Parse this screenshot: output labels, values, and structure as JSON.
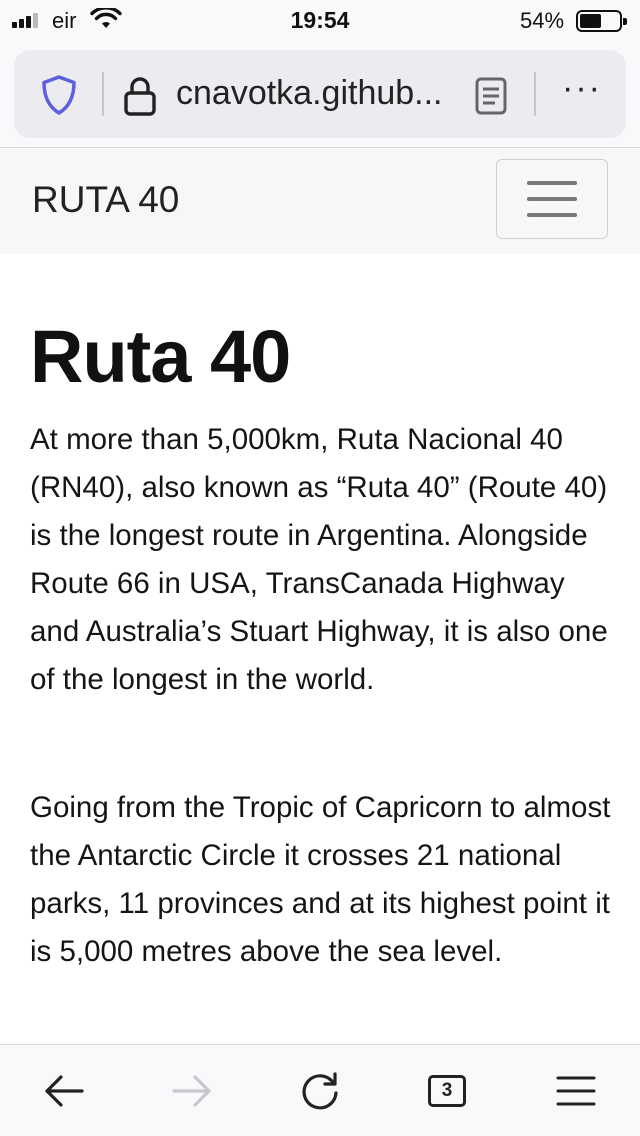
{
  "status_bar": {
    "carrier": "eir",
    "time": "19:54",
    "battery_percent": "54%",
    "battery_level": 0.54,
    "signal_bars": 3
  },
  "browser": {
    "url": "cnavotka.github...",
    "menu_label": "···",
    "tab_count": "3",
    "icons": {
      "shield": "tracking-protection-shield-icon",
      "lock": "lock-icon",
      "reader": "reader-view-icon",
      "back": "back-arrow-icon",
      "forward": "forward-arrow-icon",
      "reload": "reload-icon",
      "menu": "hamburger-menu-icon"
    },
    "accent_color": "#5b5fe0"
  },
  "site": {
    "brand": "RUTA 40",
    "title": "Ruta 40",
    "paragraphs": [
      "At more than 5,000km, Ruta Nacional 40 (RN40), also known as “Ruta 40” (Route 40) is the longest route in Argentina. Alongside Route 66 in USA, TransCanada Highway and Australia’s Stuart Highway, it is also one of the longest in the world.",
      "Going from the Tropic of Capricorn to almost the Antarctic Circle it crosses 21 national parks, 11 provinces and at its highest point it is 5,000 metres above the sea level."
    ]
  }
}
